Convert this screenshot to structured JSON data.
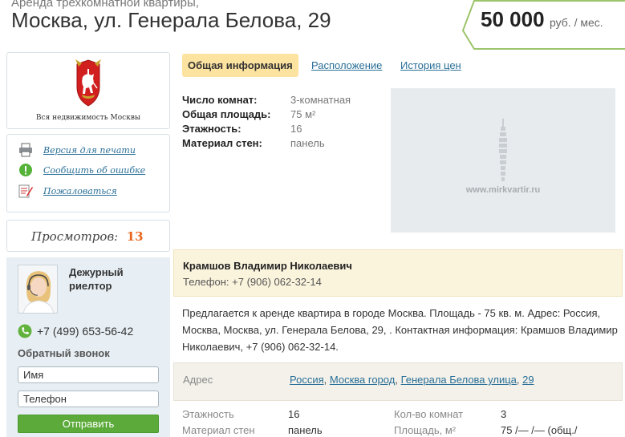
{
  "header": {
    "subtitle": "Аренда трехкомнатной квартиры,",
    "title": "Москва, ул. Генерала Белова, 29",
    "price_amount": "50 000",
    "price_unit": "руб. / мес."
  },
  "sidebar": {
    "emblem_caption": "Вся недвижимость Москвы",
    "links": [
      {
        "label": "Версия для печати",
        "icon": "printer-icon"
      },
      {
        "label": "Сообщить об ошибке",
        "icon": "exclamation-icon"
      },
      {
        "label": "Пожаловаться",
        "icon": "complaint-icon"
      }
    ],
    "views_label": "Просмотров:",
    "views_count": "13",
    "realtor_title": "Дежурный риелтор",
    "phone": "+7 (499) 653-56-42",
    "callback_title": "Обратный звонок",
    "name_placeholder": "Имя",
    "phone_placeholder": "Телефон",
    "send_label": "Отправить"
  },
  "tabs": [
    {
      "label": "Общая информация",
      "active": true
    },
    {
      "label": "Расположение",
      "active": false
    },
    {
      "label": "История цен",
      "active": false
    }
  ],
  "facts": [
    {
      "label": "Число комнат:",
      "value": "3-комнатная"
    },
    {
      "label": "Общая площадь:",
      "value": "75 м²"
    },
    {
      "label": "Этажность:",
      "value": "16"
    },
    {
      "label": "Материал стен:",
      "value": "панель"
    }
  ],
  "photo_caption": "www.mirkvartir.ru",
  "contact": {
    "name": "Крамшов Владимир Николаевич",
    "phone": "Телефон: +7 (906) 062-32-14"
  },
  "description": "Предлагается к аренде квартира в городе Москва. Площадь - 75 кв. м. Адрес: Россия, Москва, Москва, ул. Генерала Белова, 29, . Контактная информация: Крамшов Владимир Николаевич, +7 (906) 062-32-14.",
  "address": {
    "label": "Адрес",
    "parts": [
      "Россия",
      "Москва город",
      "Генерала Белова улица",
      "29"
    ]
  },
  "specs": [
    {
      "label": "Этажность",
      "value": "16"
    },
    {
      "label": "Кол-во комнат",
      "value": "3"
    },
    {
      "label": "Материал стен",
      "value": "панель"
    },
    {
      "label": "Площадь, м²",
      "value": "75 /— /— (общ./"
    }
  ],
  "colors": {
    "accent_link": "#2a6f97",
    "tab_active": "#fde3a0",
    "views_count": "#e8661c",
    "send_button": "#5cab3a",
    "price_border": "#9cc46a"
  }
}
